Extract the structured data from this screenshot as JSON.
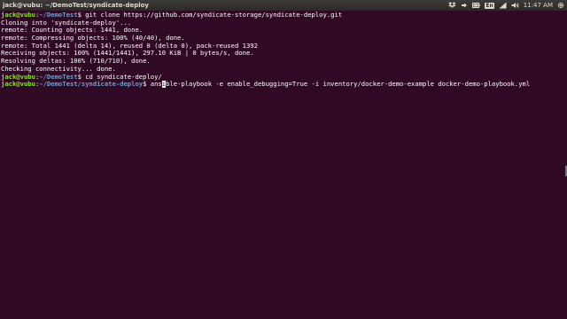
{
  "topbar": {
    "window_title": "jack@vubu: ~/DemoTest/syndicate-deploy",
    "keyboard_badge": "En",
    "clock": "11:47 AM",
    "icons": [
      "dropbox-icon",
      "arrows-sync-icon",
      "battery-icon",
      "keyboard-icon",
      "network-icon",
      "volume-icon",
      "clock",
      "gear-icon"
    ]
  },
  "terminal": {
    "user_host": "jack@vubu",
    "colon": ":",
    "cmd1": {
      "path": "~/DemoTest",
      "suffix": "$ ",
      "command": "git clone https://github.com/syndicate-storage/syndicate-deploy.git"
    },
    "output": [
      "Cloning into 'syndicate-deploy'...",
      "remote: Counting objects: 1441, done.",
      "remote: Compressing objects: 100% (40/40), done.",
      "remote: Total 1441 (delta 14), reused 0 (delta 0), pack-reused 1392",
      "Receiving objects: 100% (1441/1441), 297.10 KiB | 0 bytes/s, done.",
      "Resolving deltas: 100% (710/710), done.",
      "Checking connectivity... done."
    ],
    "cmd2": {
      "path": "~/DemoTest",
      "suffix": "$ ",
      "command": "cd syndicate-deploy/"
    },
    "cmd3": {
      "path": "~/DemoTest/syndicate-deploy",
      "suffix": "$ ",
      "before_cursor": "ans",
      "cursor_char": "i",
      "after_cursor": "ble-playbook -e enable_debugging=True -i inventory/docker-demo-example docker-demo-playbook.yml"
    }
  }
}
